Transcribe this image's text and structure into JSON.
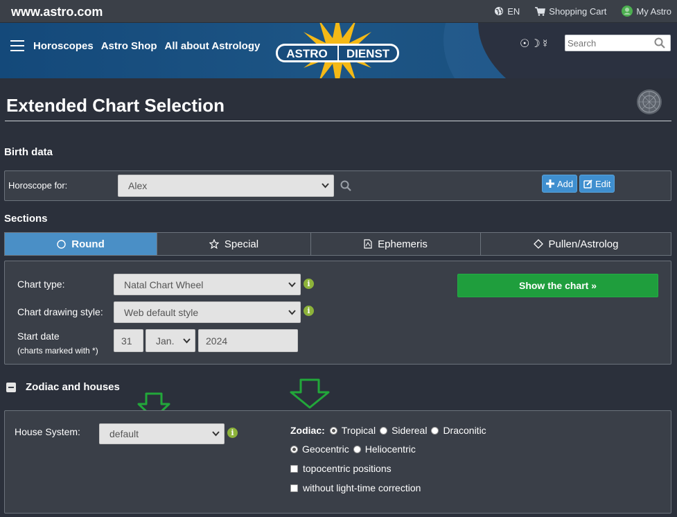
{
  "topbar": {
    "site_url": "www.astro.com",
    "language": "EN",
    "cart": "Shopping Cart",
    "account": "My Astro"
  },
  "header": {
    "nav": [
      "Horoscopes",
      "Astro Shop",
      "All about Astrology"
    ],
    "logo_left": "ASTRO",
    "logo_right": "DIENST",
    "planet_glyphs": "☉☽☿",
    "search_placeholder": "Search"
  },
  "page": {
    "title": "Extended Chart Selection"
  },
  "birth_data": {
    "heading": "Birth data",
    "horoscope_for_label": "Horoscope for:",
    "horoscope_for_value": "Alex",
    "add_label": "Add",
    "edit_label": "Edit"
  },
  "sections": {
    "heading": "Sections",
    "tabs": [
      {
        "label": "Round",
        "icon": "circle-icon",
        "active": true
      },
      {
        "label": "Special",
        "icon": "star-icon",
        "active": false
      },
      {
        "label": "Ephemeris",
        "icon": "pdf-file-icon",
        "active": false
      },
      {
        "label": "Pullen/Astrolog",
        "icon": "diamond-icon",
        "active": false
      }
    ]
  },
  "chart_options": {
    "chart_type_label": "Chart type:",
    "chart_type_value": "Natal Chart Wheel",
    "drawing_style_label": "Chart drawing style:",
    "drawing_style_value": "Web default style",
    "start_date_label": "Start date",
    "start_date_note": "(charts marked with *)",
    "start_day": "31",
    "start_month": "Jan.",
    "start_year": "2024",
    "show_chart_label": "Show the chart »"
  },
  "zodiac_houses": {
    "heading": "Zodiac and houses",
    "house_system_label": "House System:",
    "house_system_value": "default",
    "zodiac_label": "Zodiac:",
    "zodiac_options": [
      "Tropical",
      "Sidereal",
      "Draconitic"
    ],
    "zodiac_selected": "Tropical",
    "center_options": [
      "Geocentric",
      "Heliocentric"
    ],
    "center_selected": "Geocentric",
    "topocentric_label": "topocentric positions",
    "light_time_label": "without light-time correction"
  },
  "colors": {
    "page_bg": "#2b303b",
    "header_blue": "#14497a",
    "active_tab": "#4a8fc6",
    "primary_button": "#1f9e3d",
    "info_green": "#8db33a",
    "annotation_arrow": "#22a73a",
    "logo_star": "#f4b916"
  }
}
